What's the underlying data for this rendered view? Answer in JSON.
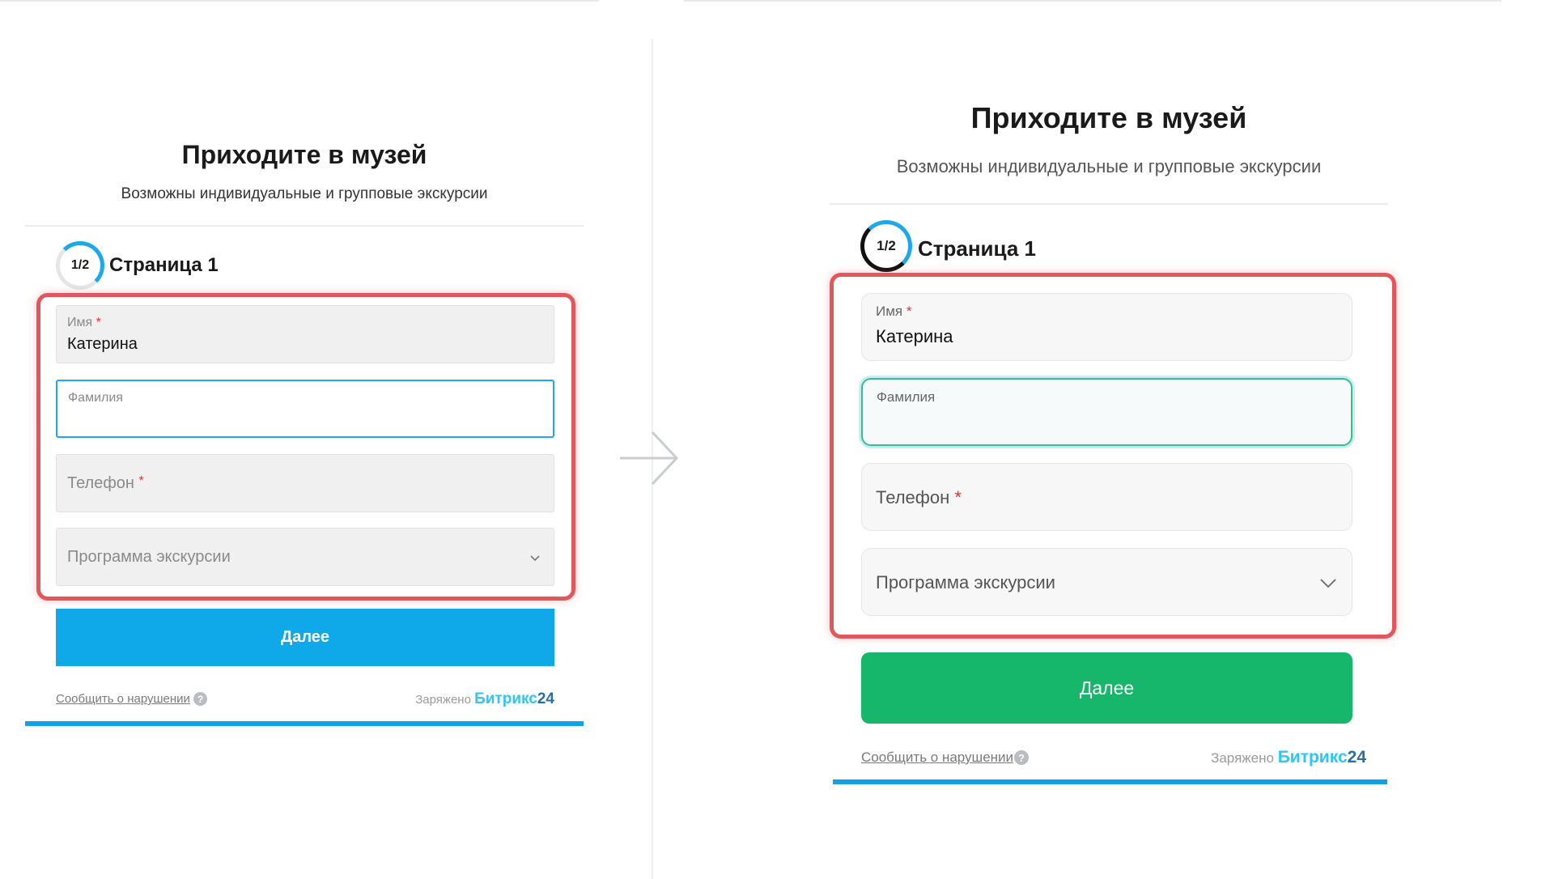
{
  "left": {
    "title": "Приходите в музей",
    "subtitle": "Возможны индивидуальные и групповые экскурсии",
    "step": "1/2",
    "page_label": "Страница 1",
    "fields": {
      "name_label": "Имя",
      "name_value": "Катерина",
      "surname_label": "Фамилия",
      "phone_label": "Телефон",
      "program_label": "Программа экскурсии"
    },
    "required_mark": "*",
    "next_button": "Далее",
    "report_link": "Сообщить о нарушении",
    "help_icon": "?",
    "powered_prefix": "Заряжено",
    "brand": "Битрикс",
    "brand_num": "24",
    "accent_color": "#0fa9ea"
  },
  "right": {
    "title": "Приходите в музей",
    "subtitle": "Возможны индивидуальные и групповые экскурсии",
    "step": "1/2",
    "page_label": "Страница 1",
    "fields": {
      "name_label": "Имя",
      "name_value": "Катерина",
      "surname_label": "Фамилия",
      "phone_label": "Телефон",
      "program_label": "Программа экскурсии"
    },
    "required_mark": "*",
    "next_button": "Далее",
    "report_link": "Сообщить о нарушении",
    "help_icon": "?",
    "powered_prefix": "Заряжено",
    "brand": "Битрикс",
    "brand_num": "24",
    "accent_color": "#16b76a"
  },
  "highlight_color": "#e3565b",
  "transition_icon": "arrow-right-icon"
}
